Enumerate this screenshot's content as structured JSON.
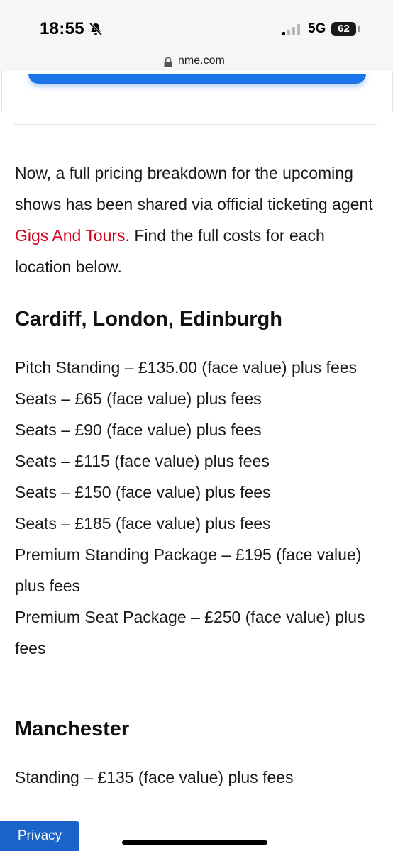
{
  "status_bar": {
    "time": "18:55",
    "network": "5G",
    "battery": "62"
  },
  "browser": {
    "url": "nme.com"
  },
  "article": {
    "intro_before_link": "Now, a full pricing breakdown for the upcoming shows has been shared via official ticketing agent ",
    "intro_link": "Gigs And Tours",
    "intro_after_link": ". Find the full costs for each location below.",
    "sections": [
      {
        "heading": "Cardiff, London, Edinburgh",
        "items": [
          "Pitch Standing – £135.00 (face value) plus fees",
          "Seats – £65 (face value) plus fees",
          "Seats – £90 (face value) plus fees",
          "Seats – £115 (face value) plus fees",
          "Seats – £150 (face value) plus fees",
          "Seats – £185 (face value) plus fees",
          "Premium Standing Package – £195 (face value) plus fees",
          "Premium Seat Package – £250 (face value) plus fees"
        ]
      },
      {
        "heading": "Manchester",
        "items": [
          "Standing – £135 (face value) plus fees"
        ]
      }
    ]
  },
  "privacy_label": "Privacy",
  "colors": {
    "link": "#d0021b",
    "button_blue": "#1a73e8",
    "privacy_blue": "#1a63c9"
  }
}
